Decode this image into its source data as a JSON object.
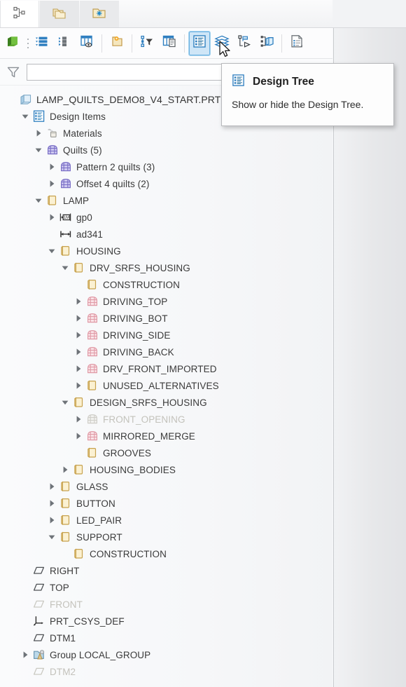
{
  "window": {
    "tabs": [
      {
        "name": "model-tree-tab",
        "icon": "model-tree-icon",
        "active": true
      },
      {
        "name": "layer-tree-tab",
        "icon": "copies-folder-icon",
        "active": false
      },
      {
        "name": "favorites-tab",
        "icon": "folder-star-icon",
        "active": false
      }
    ]
  },
  "toolbar": {
    "buttons": [
      {
        "label": "Model Display",
        "icon": "green-cube-icon",
        "pressed": false
      },
      {
        "label": "Tree Filters",
        "icon": "tree-filter-list-icon",
        "pressed": false
      },
      {
        "label": "Tree Columns",
        "icon": "tree-columns-icon",
        "pressed": false
      },
      {
        "label": "Settings",
        "icon": "table-columns-eye-icon",
        "pressed": false
      },
      {
        "label": "Folder Browser",
        "icon": "folder-gear-icon",
        "pressed": false
      },
      {
        "label": "Filter Tree",
        "icon": "node-filter-icon",
        "pressed": false
      },
      {
        "label": "Show Columns",
        "icon": "columns-doc-icon",
        "pressed": false
      },
      {
        "label": "Design Tree",
        "icon": "design-tree-icon",
        "pressed": true
      },
      {
        "label": "Layers",
        "icon": "layers-icon",
        "pressed": false
      },
      {
        "label": "Annotations",
        "icon": "annotation-flag-icon",
        "pressed": false
      },
      {
        "label": "Bodies",
        "icon": "bodies-icon",
        "pressed": false
      },
      {
        "label": "Reports",
        "icon": "report-doc-icon",
        "pressed": false
      }
    ]
  },
  "filter": {
    "icon": "funnel-icon",
    "value": "",
    "placeholder": ""
  },
  "tooltip": {
    "icon": "design-tree-icon",
    "title": "Design Tree",
    "description": "Show or hide the Design Tree."
  },
  "tree": {
    "items": [
      {
        "label": "LAMP_QUILTS_DEMO8_V4_START.PRT",
        "indent": 0,
        "icon": "part-cube-icon",
        "arrow": "none",
        "dim": false
      },
      {
        "label": "Design Items",
        "indent": 1,
        "icon": "design-tree-icon",
        "arrow": "down",
        "dim": false
      },
      {
        "label": "Materials",
        "indent": 2,
        "icon": "materials-icon",
        "arrow": "right",
        "dim": false
      },
      {
        "label": "Quilts (5)",
        "indent": 2,
        "icon": "quilt-purple-icon",
        "arrow": "down",
        "dim": false
      },
      {
        "label": "Pattern 2 quilts (3)",
        "indent": 3,
        "icon": "quilt-purple-icon",
        "arrow": "right",
        "dim": false
      },
      {
        "label": "Offset 4 quilts (2)",
        "indent": 3,
        "icon": "quilt-purple-icon",
        "arrow": "right",
        "dim": false
      },
      {
        "label": "LAMP",
        "indent": 2,
        "icon": "folder-icon",
        "arrow": "down",
        "dim": false
      },
      {
        "label": "gp0",
        "indent": 3,
        "icon": "pattern-dtm-icon",
        "arrow": "right",
        "dim": false
      },
      {
        "label": "ad341",
        "indent": 3,
        "icon": "dimension-icon",
        "arrow": "none",
        "dim": false
      },
      {
        "label": "HOUSING",
        "indent": 3,
        "icon": "folder-icon",
        "arrow": "down",
        "dim": false
      },
      {
        "label": "DRV_SRFS_HOUSING",
        "indent": 4,
        "icon": "folder-icon",
        "arrow": "down",
        "dim": false
      },
      {
        "label": "CONSTRUCTION",
        "indent": 5,
        "icon": "folder-icon",
        "arrow": "none",
        "dim": false
      },
      {
        "label": "DRIVING_TOP",
        "indent": 5,
        "icon": "quilt-pink-icon",
        "arrow": "right",
        "dim": false
      },
      {
        "label": "DRIVING_BOT",
        "indent": 5,
        "icon": "quilt-pink-icon",
        "arrow": "right",
        "dim": false
      },
      {
        "label": "DRIVING_SIDE",
        "indent": 5,
        "icon": "quilt-pink-icon",
        "arrow": "right",
        "dim": false
      },
      {
        "label": "DRIVING_BACK",
        "indent": 5,
        "icon": "quilt-pink-icon",
        "arrow": "right",
        "dim": false
      },
      {
        "label": "DRV_FRONT_IMPORTED",
        "indent": 5,
        "icon": "quilt-pink-icon",
        "arrow": "right",
        "dim": false
      },
      {
        "label": "UNUSED_ALTERNATIVES",
        "indent": 5,
        "icon": "folder-icon",
        "arrow": "right",
        "dim": false
      },
      {
        "label": "DESIGN_SRFS_HOUSING",
        "indent": 4,
        "icon": "folder-icon",
        "arrow": "down",
        "dim": false
      },
      {
        "label": "FRONT_OPENING",
        "indent": 5,
        "icon": "quilt-gray-icon",
        "arrow": "right",
        "dim": true
      },
      {
        "label": "MIRRORED_MERGE",
        "indent": 5,
        "icon": "quilt-pink-icon",
        "arrow": "right",
        "dim": false
      },
      {
        "label": "GROOVES",
        "indent": 5,
        "icon": "folder-icon",
        "arrow": "none",
        "dim": false
      },
      {
        "label": "HOUSING_BODIES",
        "indent": 4,
        "icon": "folder-icon",
        "arrow": "right",
        "dim": false
      },
      {
        "label": "GLASS",
        "indent": 3,
        "icon": "folder-icon",
        "arrow": "right",
        "dim": false
      },
      {
        "label": "BUTTON",
        "indent": 3,
        "icon": "folder-icon",
        "arrow": "right",
        "dim": false
      },
      {
        "label": "LED_PAIR",
        "indent": 3,
        "icon": "folder-icon",
        "arrow": "right",
        "dim": false
      },
      {
        "label": "SUPPORT",
        "indent": 3,
        "icon": "folder-icon",
        "arrow": "down",
        "dim": false
      },
      {
        "label": "CONSTRUCTION",
        "indent": 4,
        "icon": "folder-icon",
        "arrow": "none",
        "dim": false
      },
      {
        "label": "RIGHT",
        "indent": 1,
        "icon": "datum-plane-icon",
        "arrow": "none",
        "dim": false
      },
      {
        "label": "TOP",
        "indent": 1,
        "icon": "datum-plane-icon",
        "arrow": "none",
        "dim": false
      },
      {
        "label": "FRONT",
        "indent": 1,
        "icon": "datum-plane-gray-icon",
        "arrow": "none",
        "dim": true
      },
      {
        "label": "PRT_CSYS_DEF",
        "indent": 1,
        "icon": "csys-icon",
        "arrow": "none",
        "dim": false
      },
      {
        "label": "DTM1",
        "indent": 1,
        "icon": "datum-plane-icon",
        "arrow": "none",
        "dim": false
      },
      {
        "label": "Group LOCAL_GROUP",
        "indent": 1,
        "icon": "group-icon",
        "arrow": "right",
        "dim": false
      },
      {
        "label": "DTM2",
        "indent": 1,
        "icon": "datum-plane-gray-icon",
        "arrow": "none",
        "dim": true
      }
    ]
  },
  "colors": {
    "accent": "#1a7fc1",
    "folder": "#e6c67a",
    "quilt_purple": "#8f86d6",
    "quilt_pink": "#e8a6b0",
    "pressed_bg": "#cfe6f7",
    "panel_bg": "#f6f7f9"
  }
}
